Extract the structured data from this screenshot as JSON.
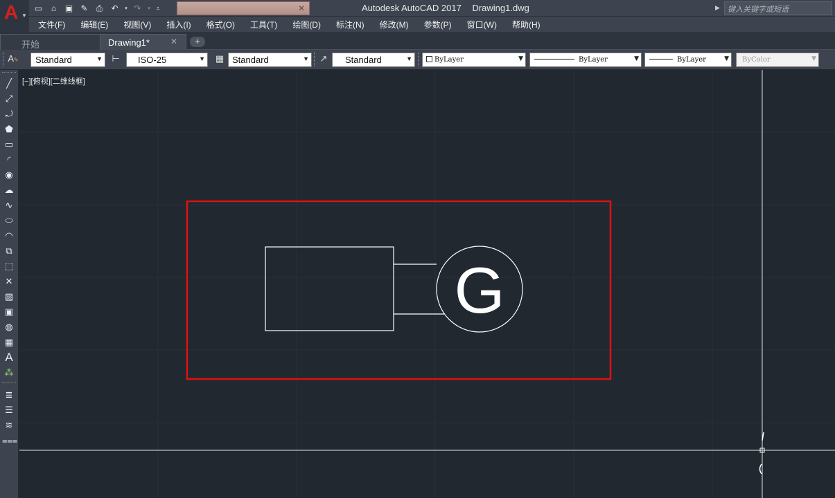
{
  "title_bar": {
    "app_name": "Autodesk AutoCAD 2017",
    "file_name": "Drawing1.dwg",
    "search_placeholder": "键入关键字或短语"
  },
  "app_logo": "A",
  "quick_access_icons": [
    "new-icon",
    "open-icon",
    "save-icon",
    "save-as-icon",
    "print-icon",
    "undo-icon",
    "redo-icon",
    "customize-icon"
  ],
  "menu": [
    "文件(F)",
    "编辑(E)",
    "视图(V)",
    "插入(I)",
    "格式(O)",
    "工具(T)",
    "绘图(D)",
    "标注(N)",
    "修改(M)",
    "参数(P)",
    "窗口(W)",
    "帮助(H)"
  ],
  "tabs": {
    "start": "开始",
    "drawing": "Drawing1*",
    "add": "+"
  },
  "styles_toolbar": {
    "text_style": "Standard",
    "dim_style": "ISO-25",
    "table_style": "Standard",
    "multileader_style": "Standard",
    "color": "ByLayer",
    "linetype": "ByLayer",
    "lineweight": "ByLayer",
    "plot_style": "ByColor"
  },
  "left_toolbar_icons": [
    "line-icon",
    "construction-line-icon",
    "polyline-icon",
    "polygon-icon",
    "rectangle-icon",
    "arc-icon",
    "circle-icon",
    "revision-cloud-icon",
    "spline-icon",
    "ellipse-icon",
    "ellipse-arc-icon",
    "insert-block-icon",
    "make-block-icon",
    "point-icon",
    "hatch-icon",
    "gradient-icon",
    "region-icon",
    "table-icon",
    "multiline-text-icon",
    "add-selected-icon",
    "layer-properties-icon",
    "layer-states-icon",
    "layer-isolate-icon",
    "layer-walk-icon"
  ],
  "left_toolbar_text_icon": "A",
  "viewport_label": "[−][俯视][二维线框]",
  "drawing": {
    "generator_letter": "G",
    "highlight_color": "#e01010",
    "line_color": "#ffffff",
    "background": "#212830"
  }
}
